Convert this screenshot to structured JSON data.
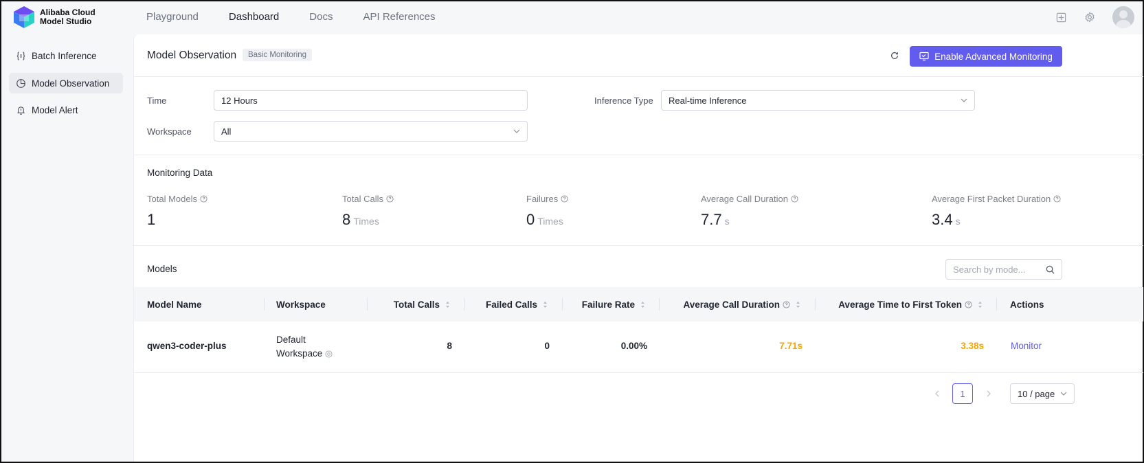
{
  "app": {
    "brand_line1": "Alibaba Cloud",
    "brand_line2": "Model Studio",
    "accent_color": "#615ced",
    "warning_color": "#f5a400"
  },
  "topnav": {
    "items": [
      "Playground",
      "Dashboard",
      "Docs",
      "API References"
    ],
    "active": "Dashboard"
  },
  "top_icons": [
    "layout-icon",
    "gear-icon",
    "avatar"
  ],
  "sidebar": {
    "items": [
      {
        "label": "Batch Inference",
        "icon": "braces-icon"
      },
      {
        "label": "Model Observation",
        "icon": "pie-chart-icon",
        "active": true
      },
      {
        "label": "Model Alert",
        "icon": "bell-icon"
      }
    ]
  },
  "header": {
    "title": "Model Observation",
    "tag": "Basic Monitoring",
    "primary_button": "Enable Advanced Monitoring"
  },
  "filters": {
    "time_label": "Time",
    "time_value": "12 Hours",
    "inference_label": "Inference Type",
    "inference_value": "Real-time Inference",
    "workspace_label": "Workspace",
    "workspace_value": "All"
  },
  "monitoring": {
    "title": "Monitoring Data",
    "stats": [
      {
        "label": "Total Models",
        "value": "1",
        "unit": ""
      },
      {
        "label": "Total Calls",
        "value": "8",
        "unit": "Times"
      },
      {
        "label": "Failures",
        "value": "0",
        "unit": "Times"
      },
      {
        "label": "Average Call Duration",
        "value": "7.7",
        "unit": "s"
      },
      {
        "label": "Average First Packet Duration",
        "value": "3.4",
        "unit": "s"
      }
    ]
  },
  "models": {
    "title": "Models",
    "search_placeholder": "Search by mode...",
    "columns": [
      "Model Name",
      "Workspace",
      "Total Calls",
      "Failed Calls",
      "Failure Rate",
      "Average Call Duration",
      "Average Time to First Token",
      "Actions"
    ],
    "rows": [
      {
        "model_name": "qwen3-coder-plus",
        "workspace_line1": "Default",
        "workspace_line2": "Workspace",
        "total_calls": "8",
        "failed_calls": "0",
        "failure_rate": "0.00%",
        "avg_call_duration": "7.71s",
        "avg_first_token": "3.38s",
        "action": "Monitor"
      }
    ]
  },
  "pagination": {
    "current_page": "1",
    "page_size": "10 / page"
  }
}
